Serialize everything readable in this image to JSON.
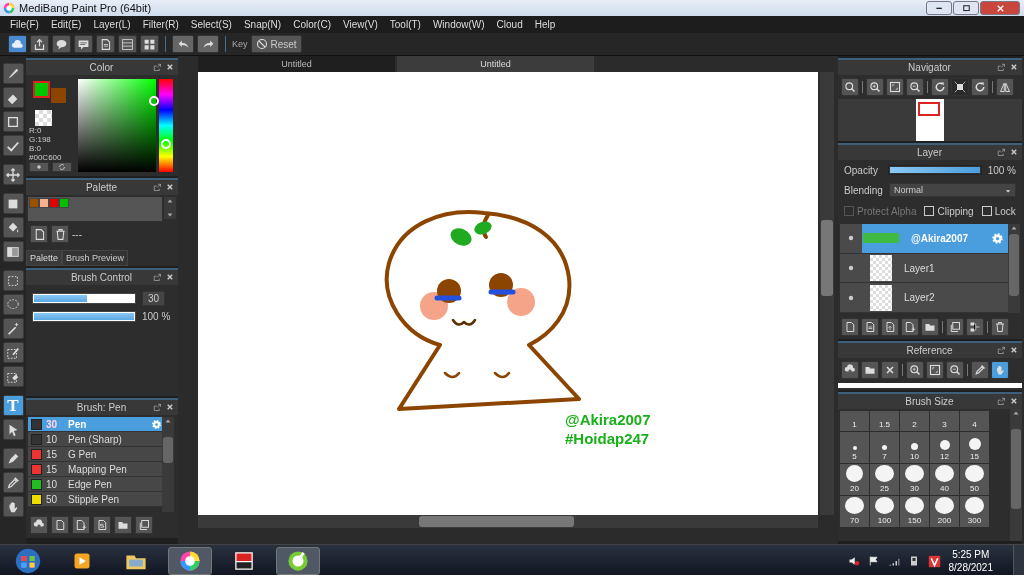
{
  "window": {
    "title": "MediBang Paint Pro (64bit)"
  },
  "menu": [
    "File(F)",
    "Edit(E)",
    "Layer(L)",
    "Filter(R)",
    "Select(S)",
    "Snap(N)",
    "Color(C)",
    "View(V)",
    "Tool(T)",
    "Window(W)",
    "Cloud",
    "Help"
  ],
  "toolbar": {
    "key_label": "Key",
    "reset_label": "Reset"
  },
  "tools": [
    {
      "kind": "brush",
      "selected": false
    },
    {
      "kind": "eraser",
      "selected": false
    },
    {
      "kind": "square",
      "selected": false
    },
    {
      "kind": "polyline",
      "selected": false
    },
    {
      "kind": "move",
      "selected": false
    },
    {
      "kind": "fillsq",
      "selected": false
    },
    {
      "kind": "bucket",
      "selected": false
    },
    {
      "kind": "gradient",
      "selected": false
    },
    {
      "kind": "selrect",
      "selected": false
    },
    {
      "kind": "lasso",
      "selected": false
    },
    {
      "kind": "wand",
      "selected": false
    },
    {
      "kind": "selpen",
      "selected": false
    },
    {
      "kind": "selerase",
      "selected": false
    },
    {
      "kind": "text",
      "glyph": "T",
      "selected": true
    },
    {
      "kind": "pointer",
      "selected": false
    },
    {
      "kind": "pen",
      "selected": false
    },
    {
      "kind": "dropper",
      "selected": false
    },
    {
      "kind": "hand",
      "selected": false
    }
  ],
  "color_panel": {
    "title": "Color",
    "main_colors": [
      {
        "color": "#00c600"
      },
      {
        "color": "#8b4500"
      }
    ],
    "readout": [
      "R:0",
      "G:198",
      "B:0",
      "#00C600"
    ]
  },
  "palette": {
    "title": "Palette",
    "colors": [
      {
        "color": "#9a5200"
      },
      {
        "color": "#f7b090"
      },
      {
        "color": "#e00000"
      },
      {
        "color": "#00c000"
      }
    ],
    "name": "---",
    "tabs": [
      {
        "label": "Palette",
        "selected": true
      },
      {
        "label": "Brush Preview",
        "selected": false
      }
    ]
  },
  "brush_control": {
    "title": "Brush Control",
    "size": {
      "level": 0.53,
      "reading": "30"
    },
    "opacity": {
      "level": 1,
      "reading": "100 %"
    }
  },
  "brush_list": {
    "title": "Brush: Pen",
    "items": [
      {
        "size": "30",
        "name": "Pen",
        "color": "#333333",
        "selected": true
      },
      {
        "size": "10",
        "name": "Pen (Sharp)",
        "color": "#333333",
        "selected": false
      },
      {
        "size": "15",
        "name": "G Pen",
        "color": "#ee3333",
        "selected": false
      },
      {
        "size": "15",
        "name": "Mapping Pen",
        "color": "#ee3333",
        "selected": false
      },
      {
        "size": "10",
        "name": "Edge Pen",
        "color": "#22bb22",
        "selected": false
      },
      {
        "size": "50",
        "name": "Stipple Pen",
        "color": "#eedd00",
        "selected": false
      }
    ]
  },
  "canvas": {
    "tabs": [
      {
        "label": "Untitled",
        "selected": false
      },
      {
        "label": "Untitled",
        "selected": true
      }
    ],
    "texts": [
      "@Akira2007",
      "#Hoidap247"
    ]
  },
  "navigator": {
    "title": "Navigator"
  },
  "layer_panel": {
    "title": "Layer",
    "opacity": {
      "label": "Opacity",
      "level": 1,
      "reading": "100 %"
    },
    "blending": {
      "label": "Blending",
      "value": "Normal"
    },
    "options": [
      {
        "label": "Protect Alpha",
        "checked": false,
        "disabled": true
      },
      {
        "label": "Clipping",
        "checked": false,
        "disabled": false
      },
      {
        "label": "Lock",
        "checked": false,
        "disabled": false
      }
    ],
    "layers": [
      {
        "name": "@Akira2007",
        "selected": true
      },
      {
        "name": "Layer1",
        "selected": false
      },
      {
        "name": "Layer2",
        "selected": false
      }
    ]
  },
  "reference": {
    "title": "Reference"
  },
  "brush_size": {
    "title": "Brush Size",
    "sizes": [
      "1",
      "1.5",
      "2",
      "3",
      "4",
      "5",
      "7",
      "10",
      "12",
      "15",
      "20",
      "25",
      "30",
      "40",
      "50",
      "70",
      "100",
      "150",
      "200",
      "300"
    ]
  },
  "taskbar": {
    "time": "5:25 PM",
    "date": "8/28/2021"
  }
}
